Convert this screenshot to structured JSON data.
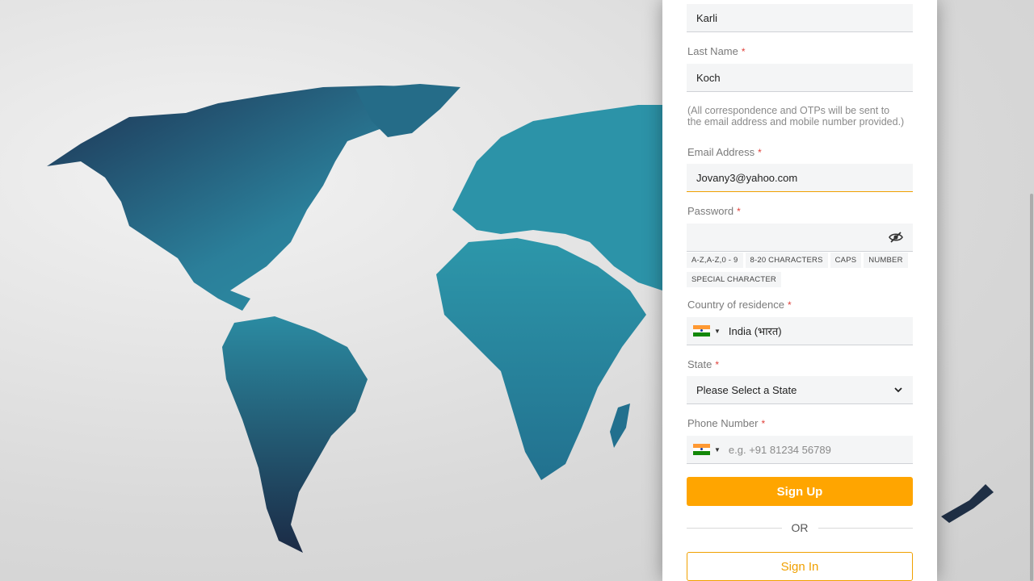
{
  "form": {
    "first_name": {
      "value": "Karli"
    },
    "last_name": {
      "label": "Last Name",
      "required_mark": "*",
      "value": "Koch"
    },
    "note": "(All correspondence and OTPs will be sent to the email address and mobile number provided.)",
    "email": {
      "label": "Email Address",
      "required_mark": "*",
      "value": "Jovany3@yahoo.com"
    },
    "password": {
      "label": "Password",
      "required_mark": "*",
      "value": "",
      "rules": [
        "A-Z,A-Z,0 - 9",
        "8-20 CHARACTERS",
        "CAPS",
        "NUMBER",
        "SPECIAL CHARACTER"
      ]
    },
    "country": {
      "label": "Country of residence",
      "required_mark": "*",
      "value": "India (भारत)"
    },
    "state": {
      "label": "State",
      "required_mark": "*",
      "value": "Please Select a State"
    },
    "phone": {
      "label": "Phone Number",
      "required_mark": "*",
      "placeholder": "e.g. +91 81234 56789"
    },
    "sign_up_label": "Sign Up",
    "or_label": "OR",
    "sign_in_label": "Sign In"
  },
  "colors": {
    "accent": "#ffa500",
    "required": "#e0403a",
    "map_teal": "#2a8fa3",
    "map_dark": "#1f3350"
  },
  "icons": [
    "eye-slash-icon",
    "india-flag-icon",
    "caret-down-icon",
    "chevron-down-icon"
  ]
}
